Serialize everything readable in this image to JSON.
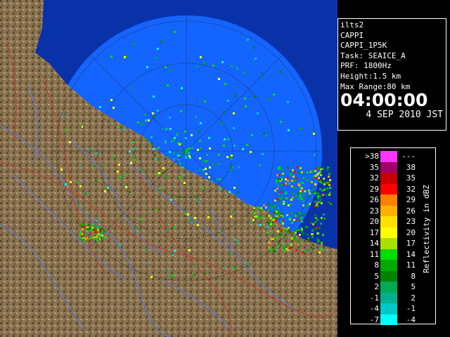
{
  "info_panel": {
    "lines": [
      "ilts2",
      "CAPPI",
      "CAPPI_1P5K",
      "Task: SEAICE_A",
      "PRF: 1800Hz",
      "Height:1.5 km",
      "Max Range:80 km"
    ],
    "time": "04:00:00",
    "date": "4 SEP 2010 JST"
  },
  "legend": {
    "unit_label": "Reflectivity in dBZ",
    "rows": [
      {
        "lo": ">38",
        "hi": "---",
        "color": "#ff33ff"
      },
      {
        "lo": "35",
        "hi": "38",
        "color": "#a0006a"
      },
      {
        "lo": "32",
        "hi": "35",
        "color": "#c80000"
      },
      {
        "lo": "29",
        "hi": "32",
        "color": "#ff0000"
      },
      {
        "lo": "26",
        "hi": "29",
        "color": "#ff7f00"
      },
      {
        "lo": "23",
        "hi": "26",
        "color": "#ffb000"
      },
      {
        "lo": "20",
        "hi": "23",
        "color": "#ffe000"
      },
      {
        "lo": "17",
        "hi": "20",
        "color": "#ffff00"
      },
      {
        "lo": "14",
        "hi": "17",
        "color": "#a8e000"
      },
      {
        "lo": "11",
        "hi": "14",
        "color": "#00dd00"
      },
      {
        "lo": "8",
        "hi": "11",
        "color": "#00aa00"
      },
      {
        "lo": "5",
        "hi": "8",
        "color": "#008400"
      },
      {
        "lo": "2",
        "hi": "5",
        "color": "#00aa55"
      },
      {
        "lo": "-1",
        "hi": "2",
        "color": "#00b090"
      },
      {
        "lo": "-4",
        "hi": "-1",
        "color": "#00c8c8"
      },
      {
        "lo": "-7",
        "hi": "-4",
        "color": "#00ffff"
      }
    ]
  },
  "map": {
    "water_color": "#1464ff",
    "outside_color": "#0a32a8",
    "land_color": "#8a7350",
    "river_color": "#5a78dc",
    "road_color": "#c83c28",
    "grid_color": "#222222"
  }
}
